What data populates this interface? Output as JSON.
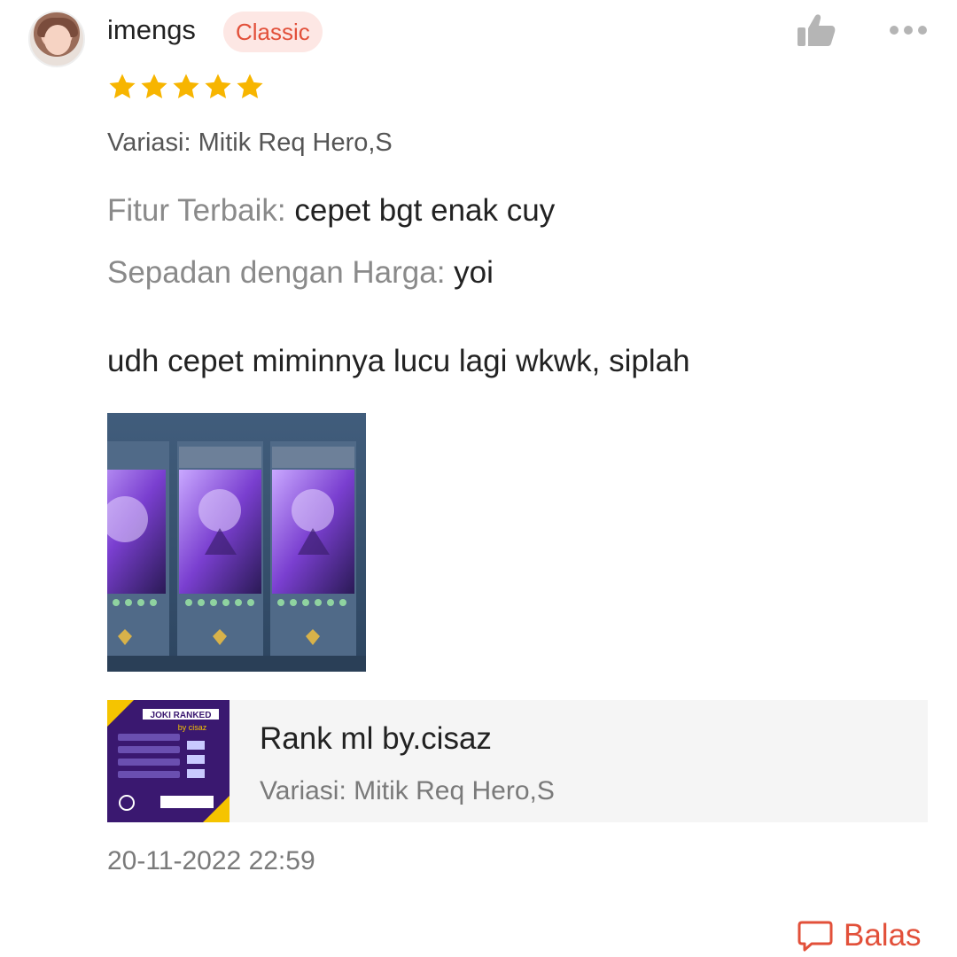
{
  "review": {
    "username": "imengs",
    "badge": "Classic",
    "rating": 5,
    "variant_label": "Variasi: Mitik Req Hero,S",
    "features": [
      {
        "label": "Fitur Terbaik:",
        "value": "cepet bgt enak cuy"
      },
      {
        "label": "Sepadan dengan Harga:",
        "value": "yoi"
      }
    ],
    "comment": "udh cepet miminnya lucu lagi wkwk, siplah",
    "timestamp": "20-11-2022 22:59",
    "reply_label": "Balas"
  },
  "product": {
    "name": "Rank ml by.cisaz",
    "variant": "Variasi: Mitik Req Hero,S",
    "thumb_title": "JOKI RANKED",
    "thumb_brand": "by cisaz"
  },
  "icons": {
    "like": "thumbs-up-icon",
    "more": "more-dots-icon",
    "star": "star-icon",
    "reply": "chat-bubble-icon"
  },
  "colors": {
    "accent": "#e2503a",
    "star": "#f7b500",
    "badge_bg": "#fde7e4",
    "muted": "#8a8a8a",
    "card_bg": "#f5f5f5"
  }
}
